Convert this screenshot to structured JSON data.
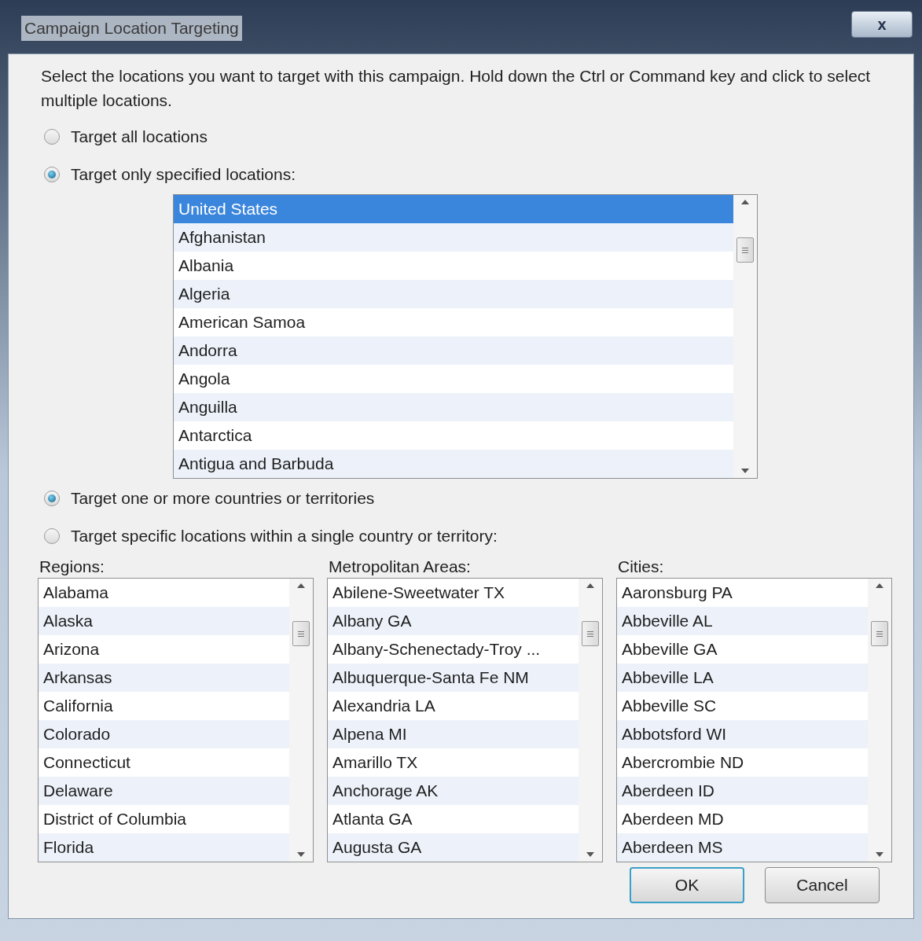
{
  "window": {
    "title": "Campaign Location Targeting",
    "close": "x"
  },
  "instructions": "Select the locations you want to target with this campaign. Hold down the Ctrl or Command key and click to select multiple locations.",
  "scope_options": [
    {
      "label": "Target all locations",
      "selected": false
    },
    {
      "label": "Target only specified locations:",
      "selected": true
    }
  ],
  "countries": [
    {
      "label": "United States",
      "selected": true
    },
    {
      "label": "Afghanistan",
      "selected": false
    },
    {
      "label": "Albania",
      "selected": false
    },
    {
      "label": "Algeria",
      "selected": false
    },
    {
      "label": "American Samoa",
      "selected": false
    },
    {
      "label": "Andorra",
      "selected": false
    },
    {
      "label": "Angola",
      "selected": false
    },
    {
      "label": "Anguilla",
      "selected": false
    },
    {
      "label": "Antarctica",
      "selected": false
    },
    {
      "label": "Antigua and Barbuda",
      "selected": false
    }
  ],
  "mode_options": [
    {
      "label": "Target one or more countries or territories",
      "selected": true
    },
    {
      "label": "Target specific locations within a single country or territory:",
      "selected": false
    }
  ],
  "lists": [
    {
      "label": "Regions:",
      "items": [
        {
          "label": "Alabama",
          "selected": false
        },
        {
          "label": "Alaska",
          "selected": false
        },
        {
          "label": "Arizona",
          "selected": false
        },
        {
          "label": "Arkansas",
          "selected": false
        },
        {
          "label": "California",
          "selected": false
        },
        {
          "label": "Colorado",
          "selected": false
        },
        {
          "label": "Connecticut",
          "selected": false
        },
        {
          "label": "Delaware",
          "selected": false
        },
        {
          "label": "District of Columbia",
          "selected": false
        },
        {
          "label": "Florida",
          "selected": false
        }
      ]
    },
    {
      "label": "Metropolitan Areas:",
      "items": [
        {
          "label": "Abilene-Sweetwater TX",
          "selected": false
        },
        {
          "label": "Albany GA",
          "selected": false
        },
        {
          "label": "Albany-Schenectady-Troy ...",
          "selected": false
        },
        {
          "label": "Albuquerque-Santa Fe NM",
          "selected": false
        },
        {
          "label": "Alexandria LA",
          "selected": false
        },
        {
          "label": "Alpena MI",
          "selected": false
        },
        {
          "label": "Amarillo TX",
          "selected": false
        },
        {
          "label": "Anchorage AK",
          "selected": false
        },
        {
          "label": "Atlanta GA",
          "selected": false
        },
        {
          "label": "Augusta GA",
          "selected": false
        }
      ]
    },
    {
      "label": "Cities:",
      "items": [
        {
          "label": "Aaronsburg PA",
          "selected": false
        },
        {
          "label": "Abbeville AL",
          "selected": false
        },
        {
          "label": "Abbeville GA",
          "selected": false
        },
        {
          "label": "Abbeville LA",
          "selected": false
        },
        {
          "label": "Abbeville SC",
          "selected": false
        },
        {
          "label": "Abbotsford WI",
          "selected": false
        },
        {
          "label": "Abercrombie ND",
          "selected": false
        },
        {
          "label": "Aberdeen ID",
          "selected": false
        },
        {
          "label": "Aberdeen MD",
          "selected": false
        },
        {
          "label": "Aberdeen MS",
          "selected": false
        }
      ]
    }
  ],
  "buttons": [
    {
      "label": "OK",
      "kind": "default"
    },
    {
      "label": "Cancel",
      "kind": "normal"
    }
  ]
}
